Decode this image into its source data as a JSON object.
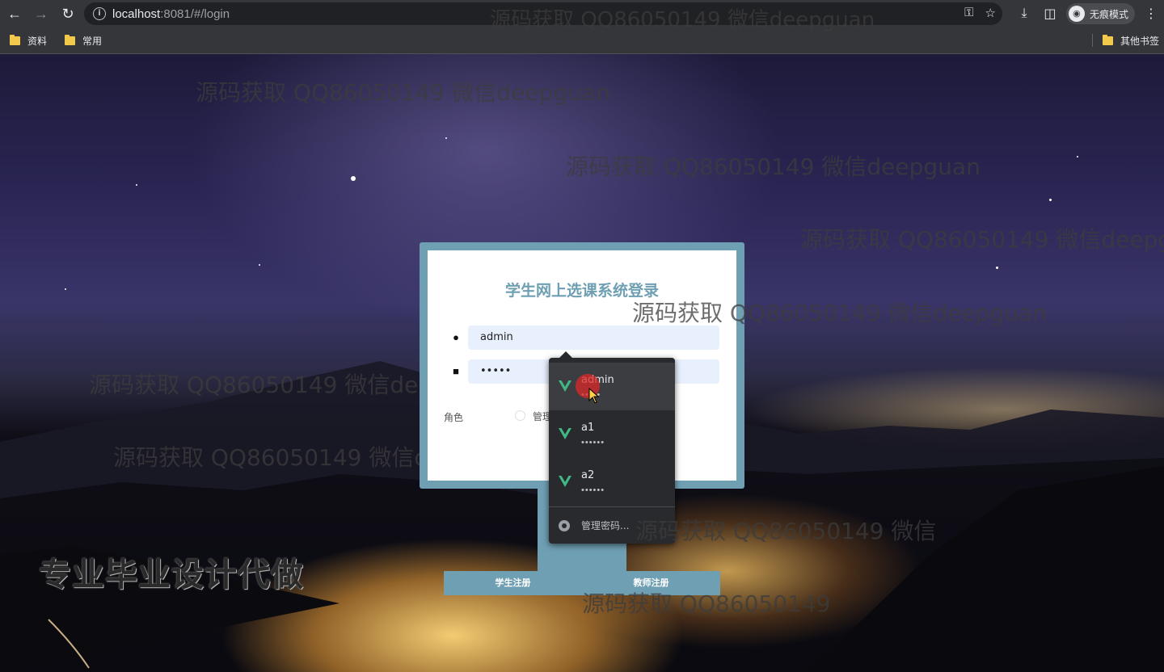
{
  "browser": {
    "url_host": "localhost",
    "url_rest": ":8081/#/login",
    "incognito_label": "无痕模式",
    "bookmarks": [
      "资料",
      "常用"
    ],
    "bookmarks_right": "其他书签"
  },
  "login": {
    "title": "学生网上选课系统登录",
    "username_value": "admin",
    "password_value": "•••••",
    "role_label": "角色",
    "role_option": "管理"
  },
  "register": {
    "student_label": "学生注册",
    "teacher_label": "教师注册"
  },
  "autofill": {
    "items": [
      {
        "user": "admin",
        "pass": "•••••"
      },
      {
        "user": "a1",
        "pass": "••••••"
      },
      {
        "user": "a2",
        "pass": "••••••"
      }
    ],
    "manage_label": "管理密码..."
  },
  "watermarks": {
    "text": "源码获取 QQ86050149 微信deepguan",
    "partial_1": "源码获取 QQ86050149 微信deepguan",
    "partial_2": "源码获取 QQ86050149 微信",
    "partial_3": "源码获取 QQ86050149",
    "side": "专业毕业设计代做"
  },
  "colors": {
    "card_accent": "#6f9fb3",
    "input_bg": "#e8f0fe",
    "dropdown_bg": "#292a2d",
    "vue_green": "#41b883"
  }
}
